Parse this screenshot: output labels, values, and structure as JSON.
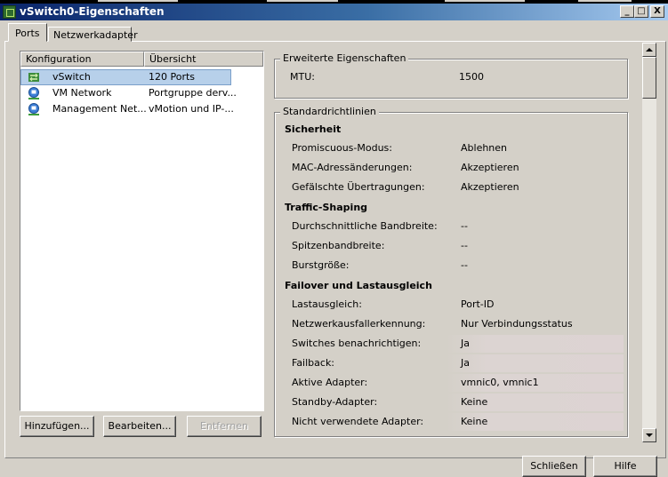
{
  "window": {
    "title": "vSwitch0-Eigenschaften",
    "minimize": "_",
    "maximize": "□",
    "close": "X"
  },
  "tabs": [
    {
      "label": "Ports",
      "active": true
    },
    {
      "label": "Netzwerkadapter",
      "active": false
    }
  ],
  "list": {
    "headers": [
      "Konfiguration",
      "Übersicht"
    ],
    "rows": [
      {
        "icon": "vswitch-icon",
        "name": "vSwitch",
        "summary": "120 Ports",
        "selected": true
      },
      {
        "icon": "vm-network-icon",
        "name": "VM Network",
        "summary": "Portgruppe derv...",
        "selected": false
      },
      {
        "icon": "management-network-icon",
        "name": "Management Net...",
        "summary": "vMotion und IP-...",
        "selected": false
      }
    ]
  },
  "buttons": {
    "add": "Hinzufügen...",
    "edit": "Bearbeiten...",
    "remove": "Entfernen",
    "close": "Schließen",
    "help": "Hilfe"
  },
  "advanced": {
    "title": "Erweiterte Eigenschaften",
    "mtu_label": "MTU:",
    "mtu_value": "1500"
  },
  "policies": {
    "title": "Standardrichtlinien",
    "security": {
      "heading": "Sicherheit",
      "rows": [
        {
          "label": "Promiscuous-Modus:",
          "value": "Ablehnen"
        },
        {
          "label": "MAC-Adressänderungen:",
          "value": "Akzeptieren"
        },
        {
          "label": "Gefälschte Übertragungen:",
          "value": "Akzeptieren"
        }
      ]
    },
    "traffic": {
      "heading": "Traffic-Shaping",
      "rows": [
        {
          "label": "Durchschnittliche Bandbreite:",
          "value": "--"
        },
        {
          "label": "Spitzenbandbreite:",
          "value": "--"
        },
        {
          "label": "Burstgröße:",
          "value": "--"
        }
      ]
    },
    "failover": {
      "heading": "Failover und Lastausgleich",
      "rows": [
        {
          "label": "Lastausgleich:",
          "value": "Port-ID"
        },
        {
          "label": "Netzwerkausfallerkennung:",
          "value": "Nur Verbindungsstatus"
        },
        {
          "label": "Switches benachrichtigen:",
          "value": "Ja"
        },
        {
          "label": "Failback:",
          "value": "Ja"
        },
        {
          "label": "Aktive Adapter:",
          "value": "vmnic0, vmnic1"
        },
        {
          "label": "Standby-Adapter:",
          "value": "Keine"
        },
        {
          "label": "Nicht verwendete Adapter:",
          "value": "Keine"
        }
      ]
    }
  },
  "colors": {
    "titlebar_start": "#0a246a",
    "titlebar_end": "#a6caf0",
    "selection": "#b7d0ea",
    "face": "#d4d0c8"
  }
}
